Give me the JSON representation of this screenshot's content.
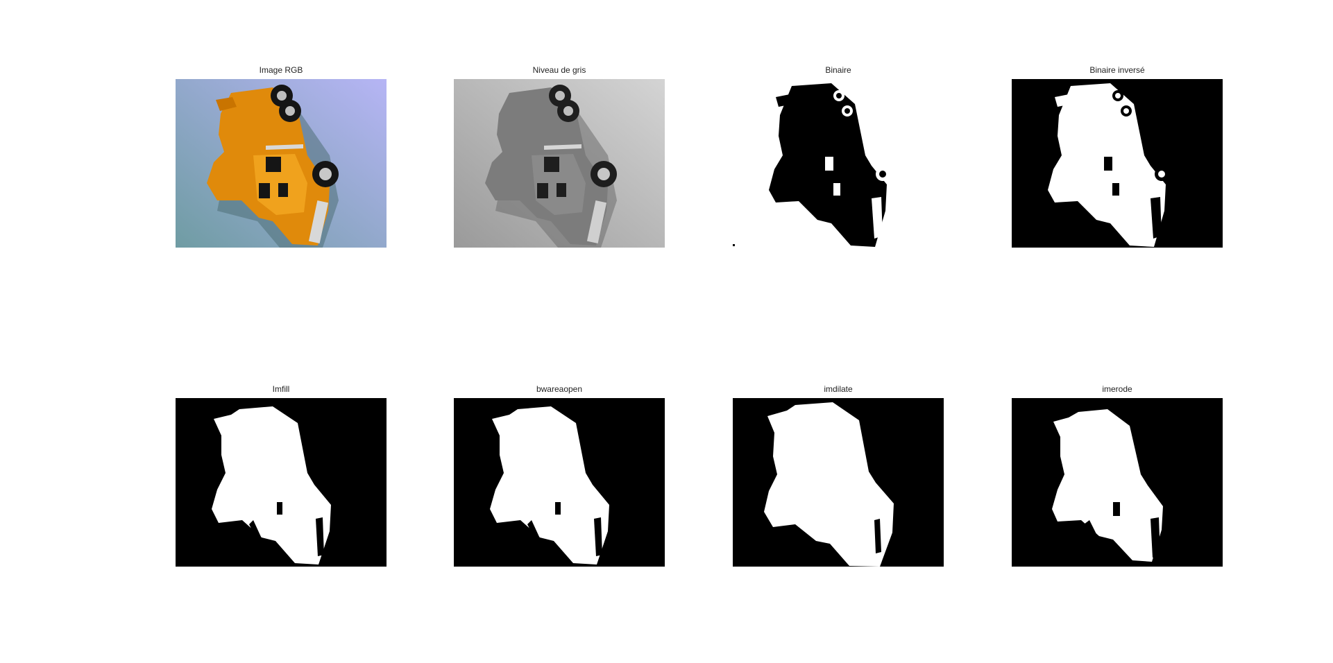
{
  "figure": {
    "panels": [
      {
        "title": "Image RGB",
        "kind": "rgb"
      },
      {
        "title": "Niveau de gris",
        "kind": "gray"
      },
      {
        "title": "Binaire",
        "kind": "binary"
      },
      {
        "title": "Binaire inversé",
        "kind": "inverted"
      },
      {
        "title": "Imfill",
        "kind": "mask"
      },
      {
        "title": "bwareaopen",
        "kind": "mask"
      },
      {
        "title": "imdilate",
        "kind": "mask"
      },
      {
        "title": "imerode",
        "kind": "mask"
      }
    ]
  },
  "colors": {
    "rgb_background_start": "#7aa3a8",
    "rgb_background_end": "#b2b3f2",
    "truck_orange": "#e68a00",
    "gray_light": "#cfcfcf",
    "gray_dark": "#5e5e5e",
    "mask_black": "#000000",
    "mask_white": "#ffffff"
  }
}
